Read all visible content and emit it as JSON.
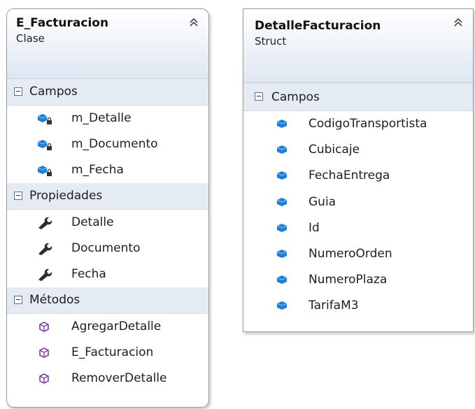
{
  "shapes": [
    {
      "title": "E_Facturacion",
      "stereotype": "Clase",
      "sections": [
        {
          "label": "Campos",
          "kind": "private-field",
          "items": [
            "m_Detalle",
            "m_Documento",
            "m_Fecha"
          ]
        },
        {
          "label": "Propiedades",
          "kind": "property",
          "items": [
            "Detalle",
            "Documento",
            "Fecha"
          ]
        },
        {
          "label": "Métodos",
          "kind": "method",
          "items": [
            "AgregarDetalle",
            "E_Facturacion",
            "RemoverDetalle"
          ]
        }
      ]
    },
    {
      "title": "DetalleFacturacion",
      "stereotype": "Struct",
      "sections": [
        {
          "label": "Campos",
          "kind": "field",
          "items": [
            "CodigoTransportista",
            "Cubicaje",
            "FechaEntrega",
            "Guia",
            "Id",
            "NumeroOrden",
            "NumeroPlaza",
            "TarifaM3"
          ]
        }
      ]
    }
  ],
  "colors": {
    "field_icon": "#1f7fd6",
    "method_icon": "#8a3aa8",
    "property_icon": "#2b2b2b",
    "section_bg": "#e4ebf3"
  }
}
